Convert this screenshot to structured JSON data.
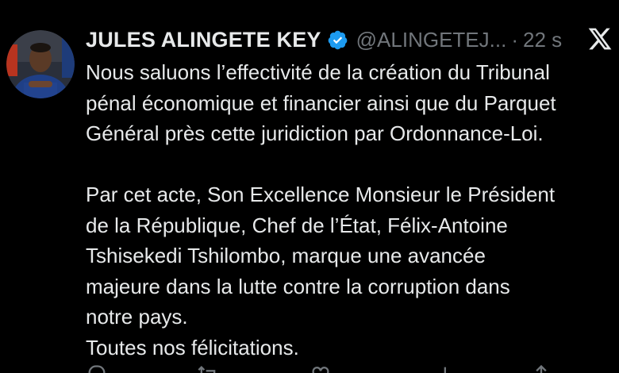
{
  "tweet": {
    "author_name": "JULES ALINGETE KEY",
    "handle": "@ALINGETEJ...",
    "separator": "·",
    "time": "22 s",
    "verified_icon": "verified-badge-icon",
    "platform_icon": "x-logo-icon",
    "body": {
      "p1": [
        "Nous saluons l’effectivité de la création du Tribunal",
        "pénal économique et financier ainsi que du Parquet",
        "Général près cette juridiction par Ordonnance-Loi."
      ],
      "p2": [
        "Par cet acte, Son Excellence Monsieur le Président",
        "de la République, Chef de l’État, Félix-Antoine",
        "Tshisekedi Tshilombo, marque une avancée",
        "majeure dans la lutte contre la corruption dans",
        "notre pays.",
        "Toutes nos félicitations."
      ]
    },
    "actions": [
      "reply-icon",
      "retweet-icon",
      "like-icon",
      "views-icon",
      "share-icon"
    ]
  },
  "colors": {
    "background": "#000000",
    "text": "#e7e9ea",
    "muted": "#71767b",
    "verified": "#1d9bf0"
  }
}
